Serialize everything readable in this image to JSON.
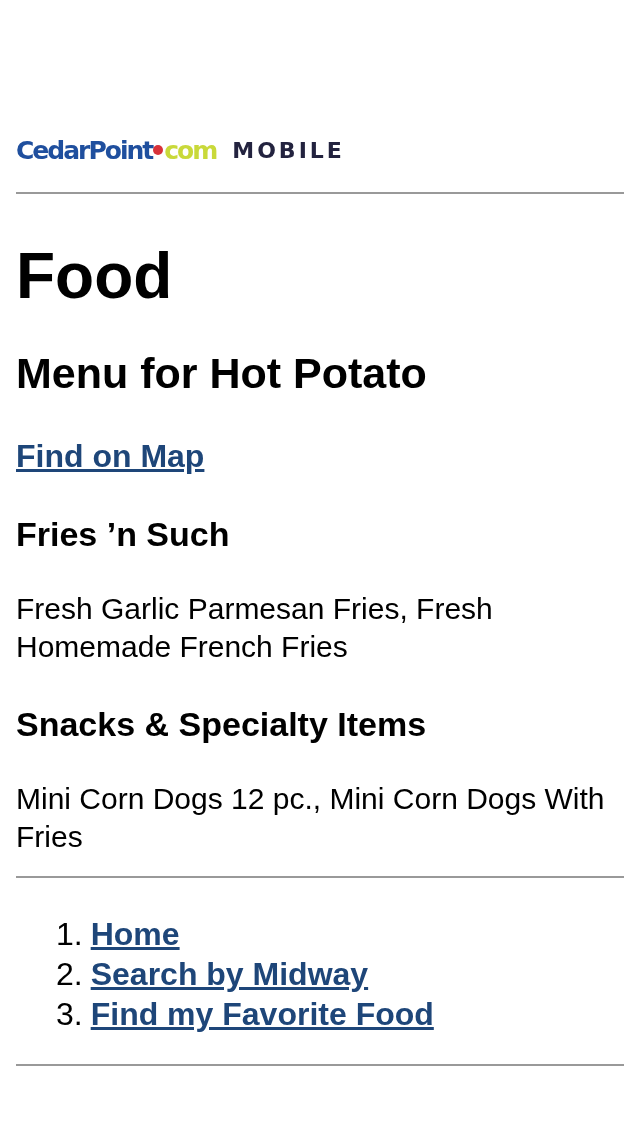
{
  "logo": {
    "name": "CedarPoint",
    "suffix": "com",
    "tag": "MOBILE"
  },
  "title": "Food",
  "subtitle": "Menu for Hot Potato",
  "map_link": "Find on Map",
  "sections": [
    {
      "heading": "Fries ’n Such",
      "text": "Fresh Garlic Parmesan Fries, Fresh Homemade French Fries"
    },
    {
      "heading": "Snacks & Specialty Items",
      "text": "Mini Corn Dogs 12 pc., Mini Corn Dogs With Fries"
    }
  ],
  "nav": [
    {
      "number": "1.",
      "label": "Home"
    },
    {
      "number": "2.",
      "label": "Search by Midway"
    },
    {
      "number": "3.",
      "label": "Find my Favorite Food"
    }
  ]
}
